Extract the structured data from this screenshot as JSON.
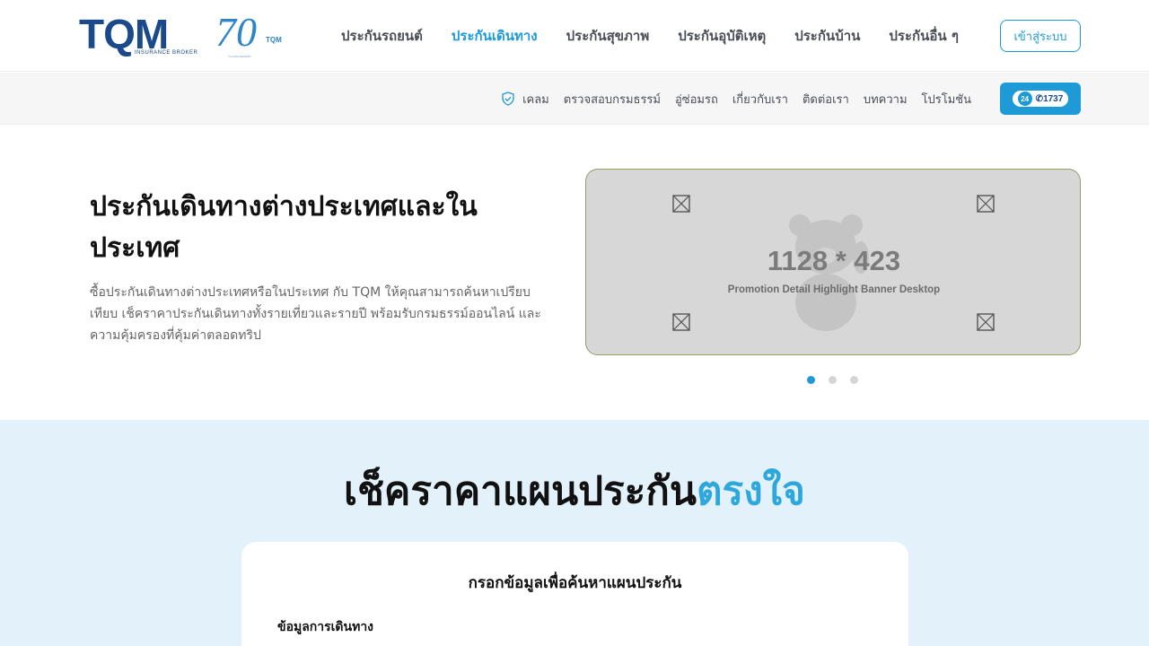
{
  "header": {
    "logo_text": "TQM",
    "logo_sub": "INSURANCE BROKER",
    "anniversary_number": "70",
    "anniversary_brand": "TQM",
    "anniversary_small": "TH ANNIVERSARY",
    "nav": [
      {
        "label": "ประกันรถยนต์",
        "active": false
      },
      {
        "label": "ประกันเดินทาง",
        "active": true
      },
      {
        "label": "ประกันสุขภาพ",
        "active": false
      },
      {
        "label": "ประกันอุบัติเหตุ",
        "active": false
      },
      {
        "label": "ประกันบ้าน",
        "active": false
      },
      {
        "label": "ประกันอื่น ๆ",
        "active": false
      }
    ],
    "login_label": "เข้าสู่ระบบ",
    "accent_color": "#1e9ad6"
  },
  "subnav": {
    "items": [
      "เคลม",
      "ตรวจสอบกรมธรรม์",
      "อู่ซ่อมรถ",
      "เกี่ยวกับเรา",
      "ติดต่อเรา",
      "บทความ",
      "โปรโมชัน"
    ],
    "claim_icon": "shield-check-icon",
    "hotline_24": "24",
    "hotline_number": "1737"
  },
  "hero": {
    "title": "ประกันเดินทางต่างประเทศและในประเทศ",
    "description": "ซื้อประกันเดินทางต่างประเทศหรือในประเทศ กับ TQM ให้คุณสามารถค้นหาเปรียบเทียบ เช็คราคาประกันเดินทางทั้งรายเที่ยวและรายปี พร้อมรับกรมธรรม์ออนไลน์ และความคุ้มครองที่คุ้มค่าตลอดทริป",
    "banner_size": "1128 * 423",
    "banner_caption": "Promotion Detail Highlight Banner Desktop",
    "slide_count": 3,
    "active_slide": 1
  },
  "check_price": {
    "title_main": "เช็คราคาแผนประกัน",
    "title_accent": "ตรงใจ",
    "card_title": "กรอกข้อมูลเพื่อค้นหาแผนประกัน",
    "section_label": "ข้อมูลการเดินทาง"
  }
}
